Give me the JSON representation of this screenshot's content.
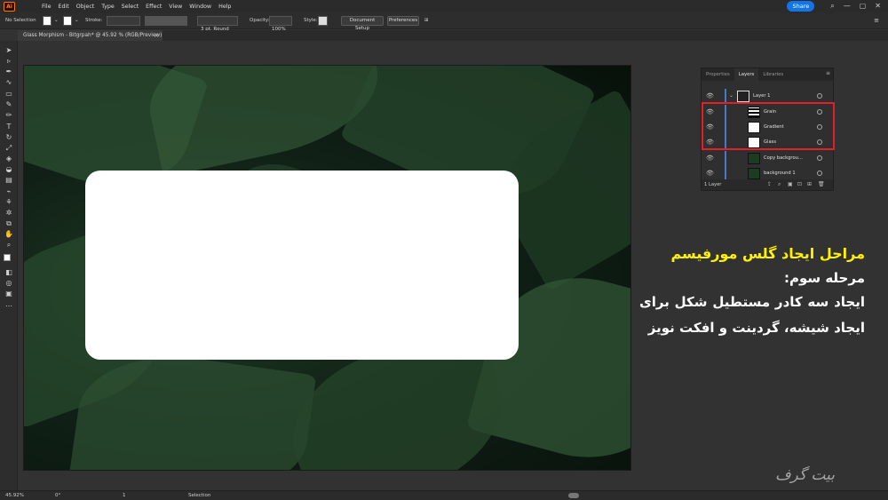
{
  "menubar": {
    "logo": "Ai",
    "items": [
      "File",
      "Edit",
      "Object",
      "Type",
      "Select",
      "Effect",
      "View",
      "Window",
      "Help"
    ],
    "share_label": "Share"
  },
  "control_bar": {
    "selection": "No Selection",
    "stroke_label": "Stroke:",
    "brush": "3 pt. Round",
    "opacity_label": "Opacity:",
    "opacity_value": "100%",
    "style_label": "Style:",
    "document_setup": "Document Setup",
    "preferences": "Preferences"
  },
  "document_tab": {
    "title": "Glass Morphism - Bitgrpah* @ 45.92 % (RGB/Preview)",
    "close": "×"
  },
  "layers_panel": {
    "tabs": [
      "Properties",
      "Layers",
      "Libraries"
    ],
    "active_tab": "Layers",
    "layers": [
      {
        "name": "Layer 1"
      },
      {
        "name": "Grain"
      },
      {
        "name": "Gradient"
      },
      {
        "name": "Glass"
      },
      {
        "name": "Copy backgrou..."
      },
      {
        "name": "background 1"
      }
    ],
    "footer_count": "1 Layer"
  },
  "tutorial": {
    "title": "مراحل ایجاد گلس مورفیسم",
    "step": "مرحله سوم:",
    "body": "ایجاد سه کادر مستطیل شکل برای ایجاد شیشه، گردینت و افکت نویز"
  },
  "status_bar": {
    "zoom": "45.92%",
    "rotation": "0°",
    "page": "1",
    "mode": "Selection"
  },
  "watermark": "بیت گرف",
  "colors": {
    "accent": "#1473e6",
    "highlight": "#e0202a",
    "title_yellow": "#fff100"
  }
}
